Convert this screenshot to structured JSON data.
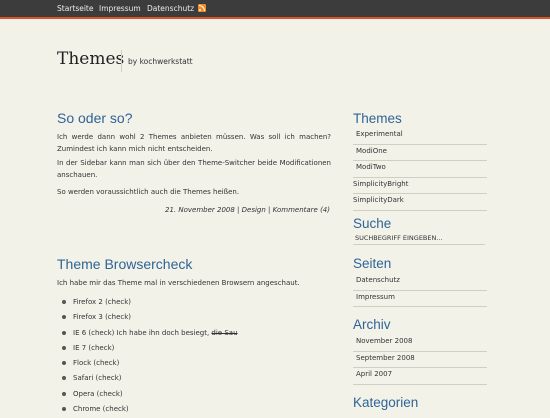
{
  "nav": {
    "items": [
      "Startseite",
      "Impressum",
      "Datenschutz"
    ],
    "rss_icon": "rss-feed-icon"
  },
  "header": {
    "title": "Themes",
    "tagline": "by kochwerkstatt"
  },
  "posts": [
    {
      "title": "So oder so?",
      "paragraphs": [
        "Ich werde dann wohl 2 Themes anbieten müssen. Was soll ich machen? Zumindest ich kann mich nicht entscheiden.",
        "In der Sidebar kann man sich über den Theme-Switcher beide Modificationen anschauen.",
        "So werden voraussichtlich auch die Themes heißen."
      ],
      "meta": {
        "date": "21. November 2008",
        "category": "Design",
        "comments": "Kommentare (4)"
      }
    },
    {
      "title": "Theme Browsercheck",
      "paragraphs": [
        "Ich habe mir das Theme mal in verschiedenen Browsern angeschaut."
      ],
      "list": [
        {
          "text": "Firefox 2 (check)"
        },
        {
          "text": "Firefox 3 (check)"
        },
        {
          "text": "IE 6 (check) Ich habe ihn doch besiegt, ",
          "struck": "die Sau"
        },
        {
          "text": "IE 7 (check)"
        },
        {
          "text": "Flock (check)"
        },
        {
          "text": "Safari (check)"
        },
        {
          "text": "Opera (check)"
        },
        {
          "text": "Chrome (check)"
        }
      ]
    }
  ],
  "sidebar": {
    "themes": {
      "heading": "Themes",
      "items": [
        "Experimental",
        "ModiOne",
        "ModiTwo",
        "SimplicityBright",
        "SimplicityDark"
      ]
    },
    "search": {
      "heading": "Suche",
      "placeholder": "SUCHBEGRIFF EINGEBEN..."
    },
    "pages": {
      "heading": "Seiten",
      "items": [
        "Datenschutz",
        "Impressum"
      ]
    },
    "archive": {
      "heading": "Archiv",
      "items": [
        "November 2008",
        "September 2008",
        "April 2007"
      ]
    },
    "categories": {
      "heading": "Kategorien"
    }
  },
  "colors": {
    "background": "#f2f2e9",
    "topbar": "#3c3c3c",
    "topbar_accent": "#d8542a",
    "heading_blue": "#2f6496"
  }
}
